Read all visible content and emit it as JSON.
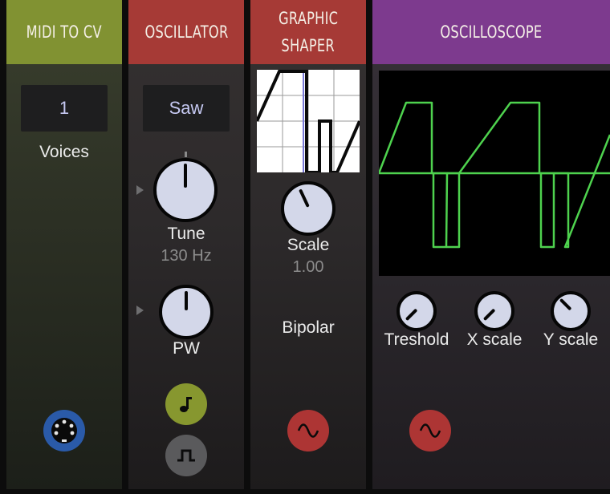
{
  "modules": {
    "midi": {
      "title": "MIDI TO CV",
      "voices_value": "1",
      "voices_label": "Voices",
      "port_icon": "midi-din-icon",
      "color": "#819232"
    },
    "oscillator": {
      "title": "OSCILLATOR",
      "waveform_value": "Saw",
      "tune_label": "Tune",
      "tune_value": "130 Hz",
      "pw_label": "PW",
      "note_port_icon": "note-icon",
      "pulse_port_icon": "pulse-wave-icon",
      "color": "#a63a36"
    },
    "shaper": {
      "title_line1": "GRAPHIC",
      "title_line2": "SHAPER",
      "scale_label": "Scale",
      "scale_value": "1.00",
      "mode_label": "Bipolar",
      "port_icon": "sine-wave-icon",
      "color": "#a63a36"
    },
    "scope": {
      "title": "OSCILLOSCOPE",
      "threshold_label": "Treshold",
      "xscale_label": "X scale",
      "yscale_label": "Y scale",
      "port_icon": "sine-wave-icon",
      "color": "#7d3a8e",
      "trace_color": "#4ed24e"
    }
  }
}
